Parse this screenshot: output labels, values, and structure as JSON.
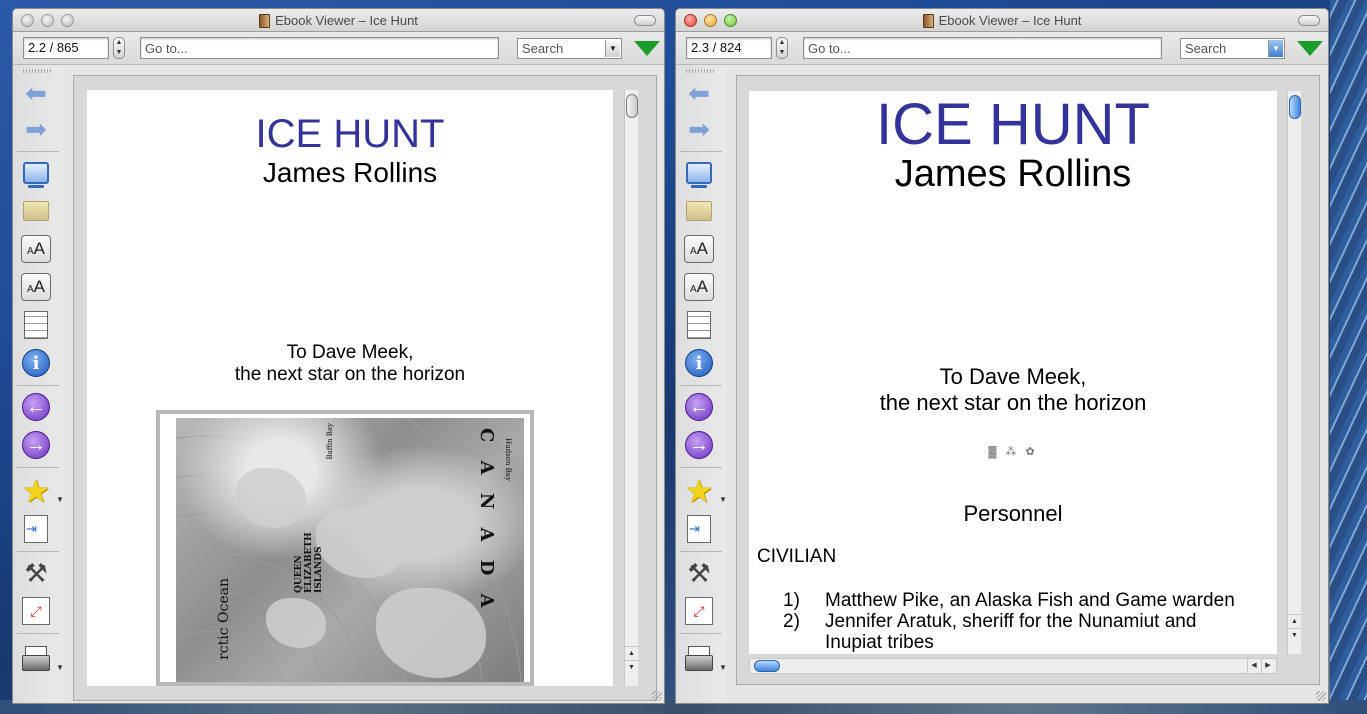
{
  "windows": [
    {
      "title": "Ebook Viewer – Ice Hunt",
      "position": "2.2 / 865",
      "goto_placeholder": "Go to...",
      "search_label": "Search",
      "content": {
        "title": "ICE HUNT",
        "author": "James Rollins",
        "dedication_line1": "To Dave Meek,",
        "dedication_line2": "the next star on the horizon",
        "map_labels": {
          "canada": "C A N A D A",
          "queen_elizabeth": "QUEEN ELIZABETH ISLANDS",
          "ocean": "rctic Ocean",
          "baffin_bay": "Baffin Bay",
          "hudson_bay": "Hudson Bay"
        }
      }
    },
    {
      "title": "Ebook Viewer – Ice Hunt",
      "position": "2.3 / 824",
      "goto_placeholder": "Go to...",
      "search_label": "Search",
      "content": {
        "title": "ICE HUNT",
        "author": "James Rollins",
        "dedication_line1": "To Dave Meek,",
        "dedication_line2": "the next star on the horizon",
        "personnel_heading": "Personnel",
        "civilian_heading": "CIVILIAN",
        "personnel_list": [
          {
            "num": "1)",
            "text": "Matthew Pike, an Alaska Fish and Game warden"
          },
          {
            "num": "2)",
            "text": "Jennifer Aratuk, sheriff for the Nunamiut and"
          },
          {
            "num": "",
            "text": "Inupiat tribes"
          }
        ]
      }
    }
  ],
  "sidebar_icons": [
    "back-arrow-icon",
    "forward-arrow-icon",
    "library-icon",
    "open-folder-icon",
    "font-larger-icon",
    "font-smaller-icon",
    "page-layout-icon",
    "info-icon",
    "previous-page-icon",
    "next-page-icon",
    "bookmark-star-icon",
    "table-of-contents-icon",
    "preferences-hammer-icon",
    "fullscreen-icon",
    "print-icon"
  ],
  "colors": {
    "title_blue": "#333399",
    "download_green": "#1c9d2a",
    "info_blue": "#1a57b8",
    "nav_purple": "#6a2fbf"
  }
}
